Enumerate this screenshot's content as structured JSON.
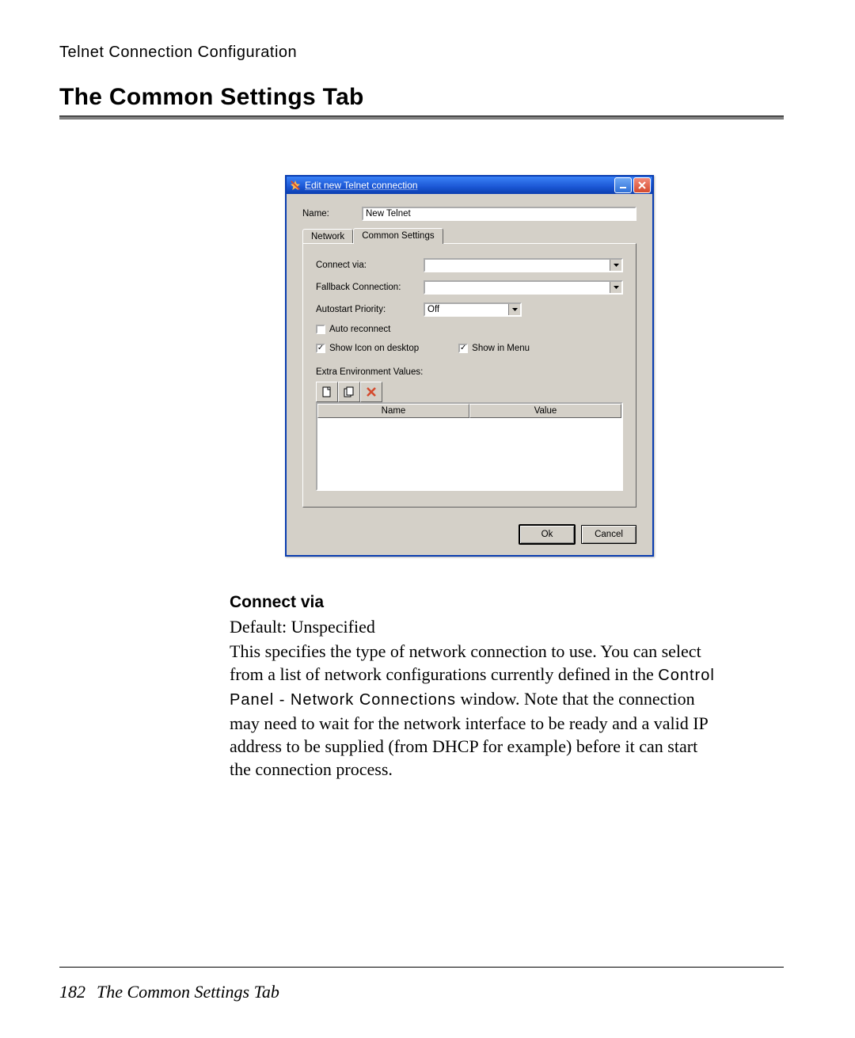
{
  "page": {
    "header_small": "Telnet Connection Configuration",
    "section_title": "The Common Settings Tab",
    "footer_page": "182",
    "footer_title": "The Common Settings Tab"
  },
  "dialog": {
    "title": "Edit new Telnet connection",
    "name_label": "Name:",
    "name_value": "New Telnet",
    "tabs": {
      "network": "Network",
      "common": "Common Settings"
    },
    "form": {
      "connect_via_label": "Connect via:",
      "fallback_label": "Fallback Connection:",
      "autostart_label": "Autostart Priority:",
      "autostart_value": "Off",
      "auto_reconnect_label": "Auto reconnect",
      "show_icon_label": "Show Icon on desktop",
      "show_menu_label": "Show in Menu",
      "env_label": "Extra Environment Values:",
      "col_name": "Name",
      "col_value": "Value"
    },
    "buttons": {
      "ok": "Ok",
      "cancel": "Cancel"
    }
  },
  "desc": {
    "heading": "Connect via",
    "default_line": "Default: Unspecified",
    "p1a": "This specifies the type of network connection to use. You can select from a list of network configurations currently defined in the ",
    "p1_code1": "Control Panel - Network Connections",
    "p1b": " window. Note that the connection may need to wait for the network interface to be ready and a valid IP address to be supplied (from DHCP for example) before it can start the connection process."
  }
}
